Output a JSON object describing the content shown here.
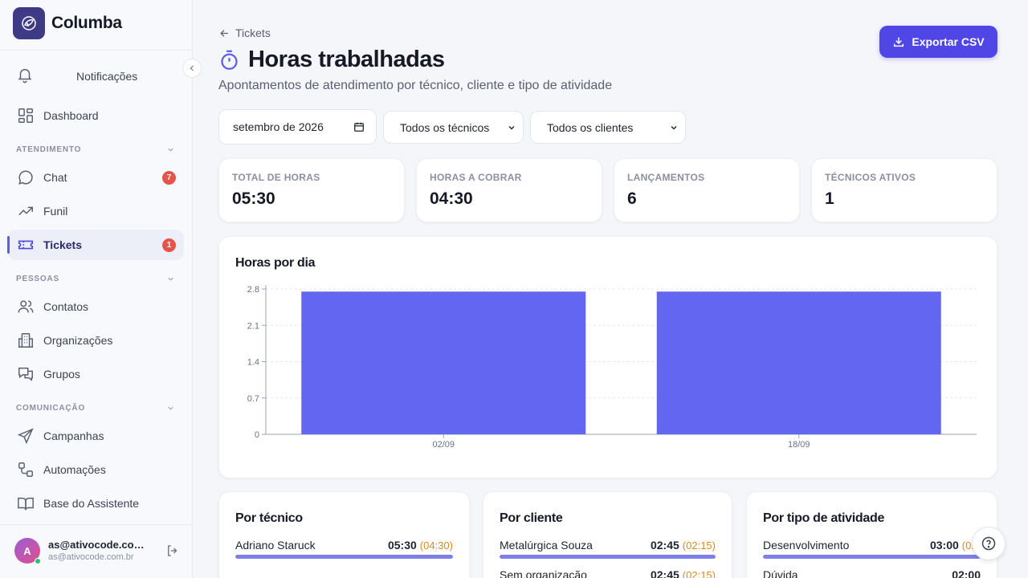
{
  "brand": {
    "name": "Columba"
  },
  "sidebar": {
    "notifications_label": "Notificações",
    "dashboard_label": "Dashboard",
    "sections": [
      {
        "title": "ATENDIMENTO",
        "items": [
          {
            "label": "Chat",
            "badge": "7"
          },
          {
            "label": "Funil"
          },
          {
            "label": "Tickets",
            "badge": "1",
            "active": true
          }
        ]
      },
      {
        "title": "PESSOAS",
        "items": [
          {
            "label": "Contatos"
          },
          {
            "label": "Organizações"
          },
          {
            "label": "Grupos"
          }
        ]
      },
      {
        "title": "COMUNICAÇÃO",
        "items": [
          {
            "label": "Campanhas"
          },
          {
            "label": "Automações"
          },
          {
            "label": "Base do Assistente"
          }
        ]
      }
    ],
    "user": {
      "initial": "A",
      "name": "as@ativocode.com.br",
      "email": "as@ativocode.com.br"
    }
  },
  "header": {
    "back_label": "Tickets",
    "title": "Horas trabalhadas",
    "subtitle": "Apontamentos de atendimento por técnico, cliente e tipo de atividade",
    "export_label": "Exportar CSV"
  },
  "filters": {
    "month": "setembro de 2026",
    "technician": "Todos os técnicos",
    "client": "Todos os clientes"
  },
  "stats": [
    {
      "label": "TOTAL DE HORAS",
      "value": "05:30"
    },
    {
      "label": "HORAS A COBRAR",
      "value": "04:30"
    },
    {
      "label": "LANÇAMENTOS",
      "value": "6"
    },
    {
      "label": "TÉCNICOS ATIVOS",
      "value": "1"
    }
  ],
  "chart_data": {
    "type": "bar",
    "title": "Horas por dia",
    "categories": [
      "02/09",
      "18/09"
    ],
    "values": [
      2.75,
      2.75
    ],
    "ylim": [
      0,
      2.8
    ],
    "yticks": [
      "0",
      "0.7",
      "1.4",
      "2.1",
      "2.8"
    ],
    "xlabel": "",
    "ylabel": "",
    "grid": true,
    "color": "#6366f1"
  },
  "breakdowns": {
    "technician": {
      "title": "Por técnico",
      "rows": [
        {
          "name": "Adriano Staruck",
          "total": "05:30",
          "billable": "(04:30)",
          "share": 1.0
        }
      ]
    },
    "client": {
      "title": "Por cliente",
      "rows": [
        {
          "name": "Metalúrgica Souza",
          "total": "02:45",
          "billable": "(02:15)",
          "share": 1.0
        },
        {
          "name": "Sem organização",
          "total": "02:45",
          "billable": "(02:15)",
          "share": 1.0
        }
      ]
    },
    "activity": {
      "title": "Por tipo de atividade",
      "rows": [
        {
          "name": "Desenvolvimento",
          "total": "03:00",
          "billable": "(02:00)",
          "share": 1.0
        },
        {
          "name": "Dúvida",
          "total": "02:00",
          "billable": "",
          "share": 0.67
        }
      ]
    }
  }
}
